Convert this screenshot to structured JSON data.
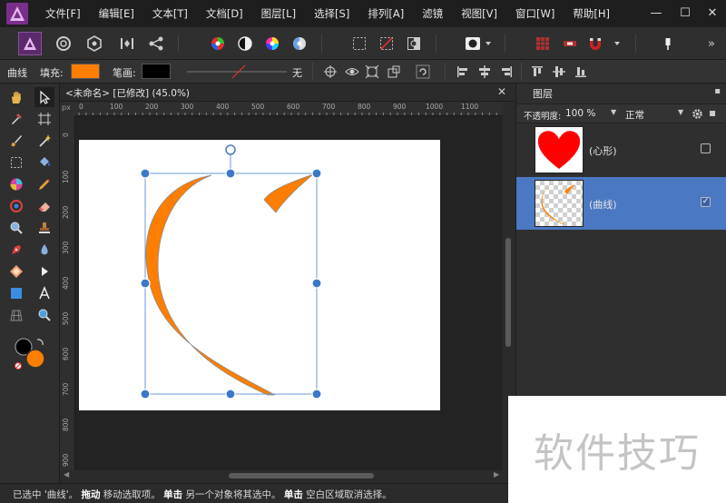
{
  "menu": {
    "items": [
      "文件[F]",
      "编辑[E]",
      "文本[T]",
      "文档[D]",
      "图层[L]",
      "选择[S]",
      "排列[A]",
      "滤镜",
      "视图[V]",
      "窗口[W]",
      "帮助[H]"
    ]
  },
  "window": {
    "minimize": "—",
    "maximize": "☐",
    "close": "✕"
  },
  "context": {
    "tool_name": "曲线",
    "fill_label": "填充:",
    "stroke_label": "笔画:",
    "stroke_none": "无",
    "fill_color": "#ff7d00",
    "stroke_color": "#000000"
  },
  "document": {
    "tab_title": "<未命名> [已修改] (45.0%)",
    "close": "✕",
    "ruler_unit": "px",
    "h_ticks": [
      "0",
      "100",
      "200",
      "300",
      "400",
      "500",
      "600",
      "700",
      "800",
      "900",
      "1000",
      "1100"
    ],
    "v_ticks": [
      "0",
      "100",
      "200",
      "300",
      "400",
      "500",
      "600",
      "700",
      "800",
      "900"
    ]
  },
  "layers_panel": {
    "tab": "图层",
    "opacity_label": "不透明度:",
    "opacity_value": "100 %",
    "blend_mode": "正常",
    "layers": [
      {
        "name": "(心形)",
        "checked": ""
      },
      {
        "name": "(曲线)",
        "checked": "✓"
      }
    ]
  },
  "status": {
    "part1": "已选中 '曲线'。",
    "bold1": "拖动",
    "part2": " 移动选取项。",
    "bold2": "单击",
    "part3": " 另一个对象将其选中。",
    "bold3": "单击",
    "part4": " 空白区域取消选择。"
  },
  "watermark": "软件技巧",
  "colors": {
    "accent_selected": "#4a78c2",
    "curve_orange": "#ff7d00",
    "heart_red": "#ff0000"
  }
}
